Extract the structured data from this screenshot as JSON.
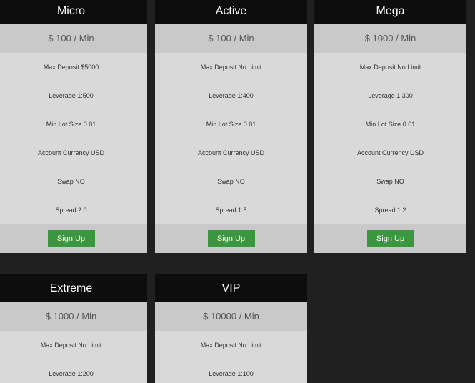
{
  "plans": [
    {
      "name": "Micro",
      "price": "$ 100 / Min",
      "features": [
        "Max Deposit $5000",
        "Leverage 1:500",
        "Min Lot Size 0.01",
        "Account Currency USD",
        "Swap NO",
        "Spread 2.0"
      ],
      "button": "Sign Up"
    },
    {
      "name": "Active",
      "price": "$ 100 / Min",
      "features": [
        "Max Deposit No Limit",
        "Leverage 1:400",
        "Min Lot Size 0.01",
        "Account Currency USD",
        "Swap NO",
        "Spread 1.5"
      ],
      "button": "Sign Up"
    },
    {
      "name": "Mega",
      "price": "$ 1000 / Min",
      "features": [
        "Max Deposit No Limit",
        "Leverage 1:300",
        "Min Lot Size 0.01",
        "Account Currency USD",
        "Swap NO",
        "Spread 1.2"
      ],
      "button": "Sign Up"
    },
    {
      "name": "Extreme",
      "price": "$ 1000 / Min",
      "features": [
        "Max Deposit No Limit",
        "Leverage 1:200"
      ]
    },
    {
      "name": "VIP",
      "price": "$ 10000 / Min",
      "features": [
        "Max Deposit No Limit",
        "Leverage 1:100"
      ]
    }
  ],
  "colors": {
    "header_bg": "#0d0d0d",
    "card_bg": "#d9d9d9",
    "price_bg": "#c9c9c9",
    "button_bg": "#3a9740"
  }
}
